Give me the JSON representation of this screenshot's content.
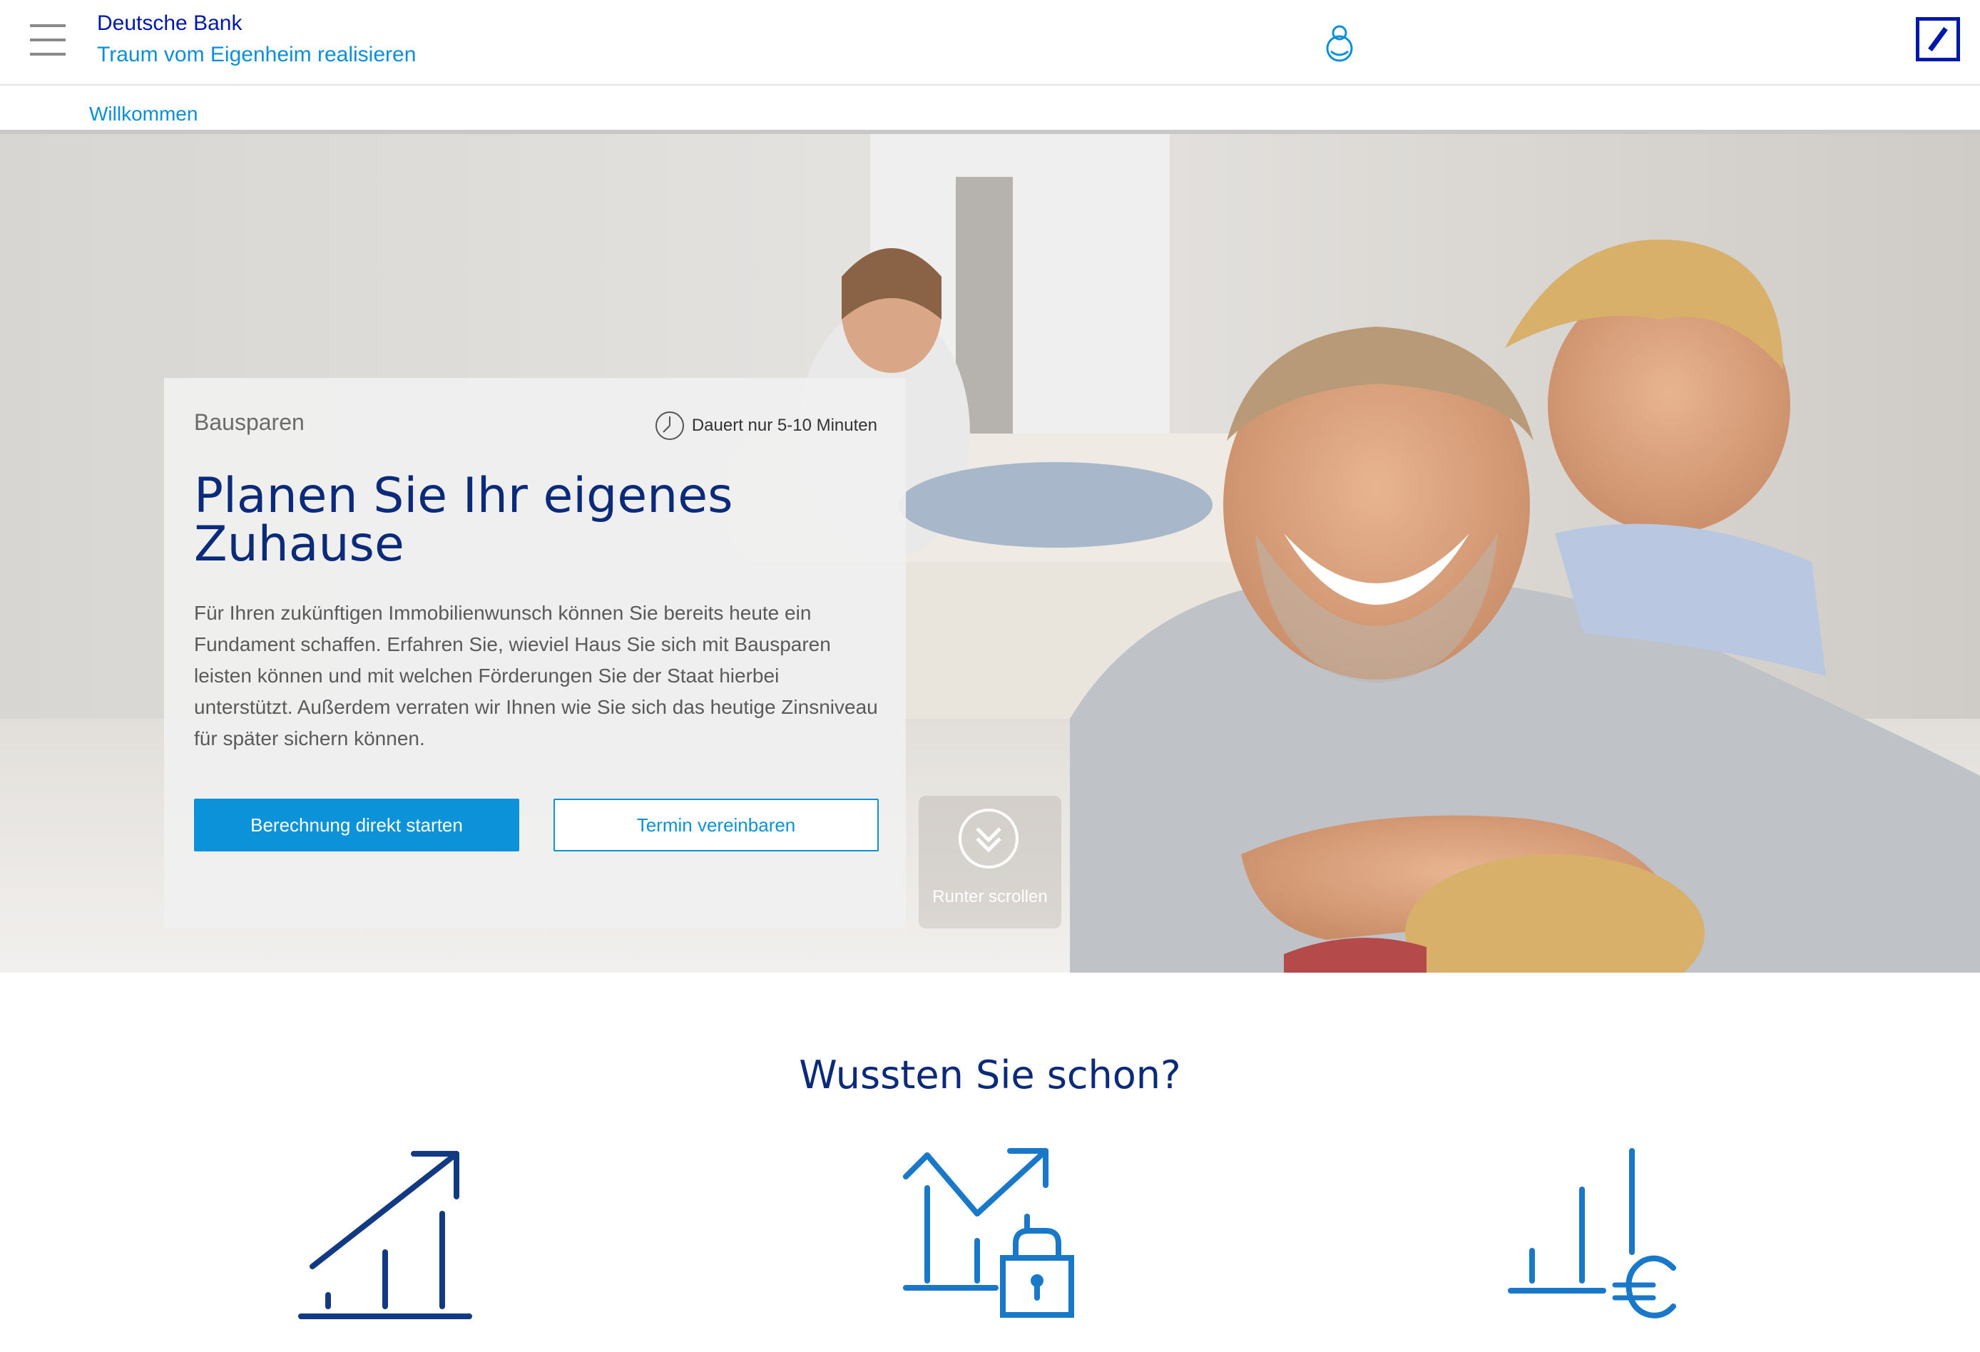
{
  "header": {
    "brand": "Deutsche Bank",
    "subtitle": "Traum vom Eigenheim realisieren",
    "menu_icon": "hamburger-menu-icon",
    "user_icon": "user-icon",
    "logo_icon": "deutsche-bank-logo"
  },
  "tabs": [
    {
      "label": "Willkommen",
      "active": true
    }
  ],
  "hero": {
    "kicker": "Bausparen",
    "duration": "Dauert nur 5-10 Minuten",
    "title": "Planen Sie Ihr eigenes Zuhause",
    "body": "Für Ihren zukünftigen Immobilienwunsch können Sie bereits heute ein Fundament schaffen. Erfahren Sie, wieviel Haus Sie sich mit Bausparen leisten können und mit welchen Förderungen Sie der Staat hierbei unterstützt. Außerdem verraten wir Ihnen wie Sie sich das heutige Zinsniveau für später sichern können.",
    "primary_button": "Berechnung direkt starten",
    "secondary_button": "Termin vereinbaren",
    "scroll_label": "Runter scrollen"
  },
  "section": {
    "title": "Wussten Sie schon?",
    "icons": [
      "growth-chart-icon",
      "secured-rate-icon",
      "euro-savings-icon"
    ]
  },
  "colors": {
    "brand_navy": "#0018a8",
    "accent_blue": "#0c92d9",
    "heading_navy": "#0b2a7a"
  }
}
